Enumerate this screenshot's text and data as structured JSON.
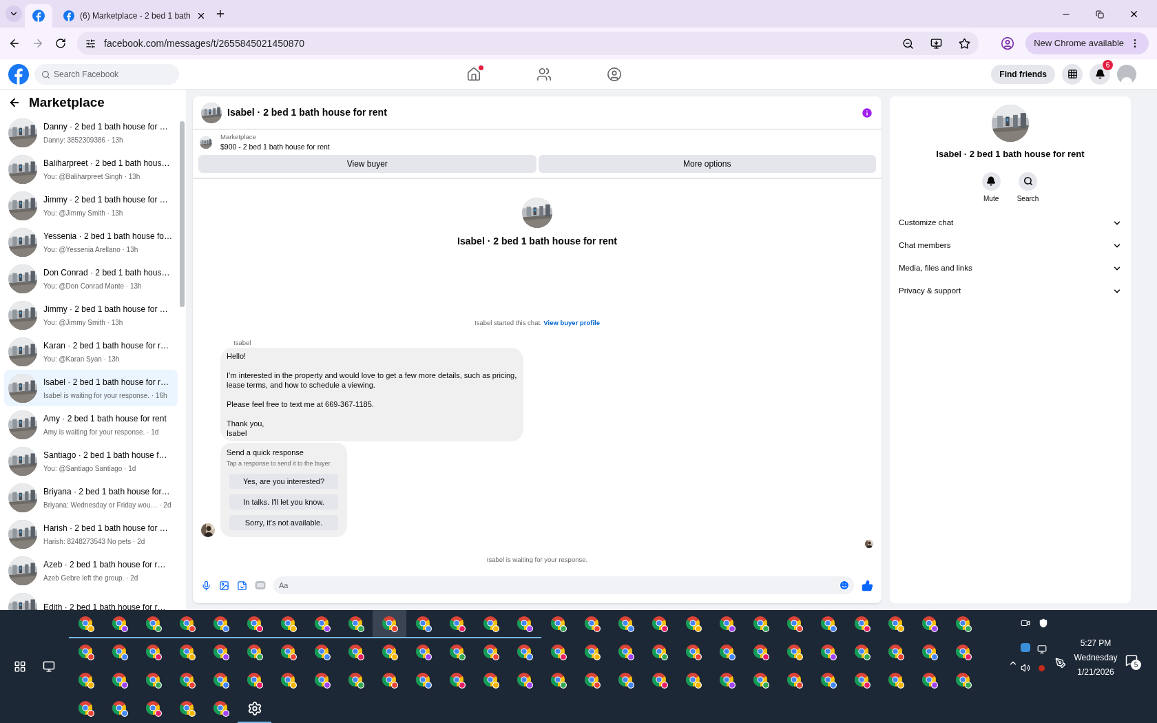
{
  "browser": {
    "tabs": [
      {
        "kind": "icon",
        "selected": true
      },
      {
        "kind": "page",
        "title": "(6) Marketplace - 2 bed 1 bath",
        "selected": false
      }
    ],
    "url": "facebook.com/messages/t/2655845021450870",
    "update_label": "New Chrome available"
  },
  "facebook": {
    "search_placeholder": "Search Facebook",
    "nav": [
      {
        "kind": "home",
        "dot": true
      },
      {
        "kind": "friends",
        "dot": false
      },
      {
        "kind": "groups",
        "dot": false
      }
    ],
    "find_friends": "Find friends",
    "notifications_badge": "6"
  },
  "sidebar": {
    "title": "Marketplace",
    "conversations": [
      {
        "title": "Danny · 2 bed 1 bath house for …",
        "subtitle": "Danny: 3852309386 · 13h",
        "selected": false
      },
      {
        "title": "Baliharpreet · 2 bed 1 bath hous…",
        "subtitle": "You: @Baliharpreet Singh · 13h",
        "selected": false
      },
      {
        "title": "Jimmy · 2 bed 1 bath house for …",
        "subtitle": "You: @Jimmy Smith · 13h",
        "selected": false
      },
      {
        "title": "Yessenia · 2 bed 1 bath house fo…",
        "subtitle": "You: @Yessenia Arellano · 13h",
        "selected": false
      },
      {
        "title": "Don Conrad · 2 bed 1 bath hous…",
        "subtitle": "You: @Don Conrad Mante · 13h",
        "selected": false
      },
      {
        "title": "Jimmy · 2 bed 1 bath house for …",
        "subtitle": "You: @Jimmy Smith · 13h",
        "selected": false
      },
      {
        "title": "Karan · 2 bed 1 bath house for r…",
        "subtitle": "You: @Karan Syan · 13h",
        "selected": false
      },
      {
        "title": "Isabel · 2 bed 1 bath house for r…",
        "subtitle": "Isabel is waiting for your response. · 16h",
        "selected": true
      },
      {
        "title": "Amy · 2 bed 1 bath house for rent",
        "subtitle": "Amy is waiting for your response. · 1d",
        "selected": false
      },
      {
        "title": "Santiago · 2 bed 1 bath house f…",
        "subtitle": "You: @Santiago Santiago · 1d",
        "selected": false
      },
      {
        "title": "Briyana · 2 bed 1 bath house for…",
        "subtitle": "Briyana: Wednesday or Friday wou… · 2d",
        "selected": false
      },
      {
        "title": "Harish · 2 bed 1 bath house for …",
        "subtitle": "Harish: 8248273543 No pets · 2d",
        "selected": false
      },
      {
        "title": "Azeb · 2 bed 1 bath house for r…",
        "subtitle": "Azeb Gebre left the group. · 2d",
        "selected": false
      },
      {
        "title": "Edith · 2 bed 1 bath house for r…",
        "selected": false
      }
    ]
  },
  "chat": {
    "title": "Isabel · 2 bed 1 bath house for rent",
    "listing": {
      "label": "Marketplace",
      "name": "$900 - 2 bed 1 bath house for rent",
      "buttons": [
        "View buyer",
        "More options"
      ]
    },
    "intro_title": "Isabel · 2 bed 1 bath house for rent",
    "started_text": "Isabel started this chat.",
    "started_link": "View buyer profile",
    "sender": "Isabel",
    "message": [
      "Hello!",
      "I’m interested in the property and would love to get a few more details, such as pricing, lease terms, and how to schedule a viewing.",
      "Please feel free to text me at 669-367-1185.",
      "Thank you,\nIsabel"
    ],
    "quick_response": {
      "title": "Send a quick response",
      "hint": "Tap a response to send it to the buyer.",
      "options": [
        "Yes, are you interested?",
        "In talks. I'll let you know.",
        "Sorry, it's not available."
      ]
    },
    "waiting_text": "Isabel is waiting for your response.",
    "composer_placeholder": "Aa"
  },
  "details": {
    "title": "Isabel · 2 bed 1 bath house for rent",
    "actions": [
      {
        "kind": "mute",
        "label": "Mute"
      },
      {
        "kind": "search",
        "label": "Search"
      }
    ],
    "sections": [
      {
        "label": "Customize chat",
        "expanded": false
      },
      {
        "label": "Chat members",
        "expanded": false
      },
      {
        "label": "Media, files and links",
        "expanded": false
      },
      {
        "label": "Privacy & support",
        "expanded": false
      }
    ]
  },
  "taskbar": {
    "apps": [
      {
        "kind": "chrome",
        "running": true,
        "active": false
      },
      {
        "kind": "chrome",
        "running": true,
        "active": false
      },
      {
        "kind": "chrome",
        "running": true,
        "active": false
      },
      {
        "kind": "chrome",
        "running": true,
        "active": false
      },
      {
        "kind": "chrome",
        "running": true,
        "active": false
      },
      {
        "kind": "chrome",
        "running": true,
        "active": false
      },
      {
        "kind": "chrome",
        "running": true,
        "active": false
      },
      {
        "kind": "chrome",
        "running": true,
        "active": false
      },
      {
        "kind": "chrome",
        "running": true,
        "active": false
      },
      {
        "kind": "chrome",
        "running": true,
        "active": true
      },
      {
        "kind": "chrome",
        "running": true,
        "active": false
      },
      {
        "kind": "chrome",
        "running": true,
        "active": false
      },
      {
        "kind": "chrome",
        "running": true,
        "active": false
      },
      {
        "kind": "chrome",
        "running": true,
        "active": false
      },
      {
        "kind": "chrome",
        "running": false,
        "active": false
      },
      {
        "kind": "chrome",
        "running": false,
        "active": false
      },
      {
        "kind": "chrome",
        "running": false,
        "active": false
      },
      {
        "kind": "chrome",
        "running": false,
        "active": false
      },
      {
        "kind": "chrome",
        "running": false,
        "active": false
      },
      {
        "kind": "chrome",
        "running": false,
        "active": false
      },
      {
        "kind": "chrome",
        "running": false,
        "active": false
      },
      {
        "kind": "chrome",
        "running": false,
        "active": false
      },
      {
        "kind": "chrome",
        "running": false,
        "active": false
      },
      {
        "kind": "chrome",
        "running": false,
        "active": false
      },
      {
        "kind": "chrome",
        "running": false,
        "active": false
      },
      {
        "kind": "chrome",
        "running": false,
        "active": false
      },
      {
        "kind": "chrome",
        "running": false,
        "active": false
      },
      {
        "kind": "chrome",
        "running": false,
        "active": false
      },
      {
        "kind": "chrome",
        "running": false,
        "active": false
      },
      {
        "kind": "chrome",
        "running": false,
        "active": false
      },
      {
        "kind": "chrome",
        "running": false,
        "active": false
      },
      {
        "kind": "chrome",
        "running": false,
        "active": false
      },
      {
        "kind": "chrome",
        "running": false,
        "active": false
      },
      {
        "kind": "chrome",
        "running": false,
        "active": false
      },
      {
        "kind": "chrome",
        "running": false,
        "active": false
      },
      {
        "kind": "chrome",
        "running": false,
        "active": false
      },
      {
        "kind": "chrome",
        "running": false,
        "active": false
      },
      {
        "kind": "chrome",
        "running": false,
        "active": false
      },
      {
        "kind": "chrome",
        "running": false,
        "active": false
      },
      {
        "kind": "chrome",
        "running": false,
        "active": false
      },
      {
        "kind": "chrome",
        "running": false,
        "active": false
      },
      {
        "kind": "chrome",
        "running": false,
        "active": false
      },
      {
        "kind": "chrome",
        "running": false,
        "active": false
      },
      {
        "kind": "chrome",
        "running": false,
        "active": false
      },
      {
        "kind": "chrome",
        "running": false,
        "active": false
      },
      {
        "kind": "chrome",
        "running": false,
        "active": false
      },
      {
        "kind": "chrome",
        "running": false,
        "active": false
      },
      {
        "kind": "chrome",
        "running": false,
        "active": false
      },
      {
        "kind": "chrome",
        "running": false,
        "active": false
      },
      {
        "kind": "chrome",
        "running": false,
        "active": false
      },
      {
        "kind": "chrome",
        "running": false,
        "active": false
      },
      {
        "kind": "chrome",
        "running": false,
        "active": false
      },
      {
        "kind": "chrome",
        "running": false,
        "active": false
      },
      {
        "kind": "chrome",
        "running": false,
        "active": false
      },
      {
        "kind": "chrome",
        "running": false,
        "active": false
      },
      {
        "kind": "chrome",
        "running": false,
        "active": false
      },
      {
        "kind": "chrome",
        "running": false,
        "active": false
      },
      {
        "kind": "chrome",
        "running": false,
        "active": false
      },
      {
        "kind": "chrome",
        "running": false,
        "active": false
      },
      {
        "kind": "chrome",
        "running": false,
        "active": false
      },
      {
        "kind": "chrome",
        "running": false,
        "active": false
      },
      {
        "kind": "chrome",
        "running": false,
        "active": false
      },
      {
        "kind": "chrome",
        "running": false,
        "active": false
      },
      {
        "kind": "chrome",
        "running": false,
        "active": false
      },
      {
        "kind": "chrome",
        "running": false,
        "active": false
      },
      {
        "kind": "chrome",
        "running": false,
        "active": false
      },
      {
        "kind": "chrome",
        "running": false,
        "active": false
      },
      {
        "kind": "chrome",
        "running": false,
        "active": false
      },
      {
        "kind": "chrome",
        "running": false,
        "active": false
      },
      {
        "kind": "chrome",
        "running": false,
        "active": false
      },
      {
        "kind": "chrome",
        "running": false,
        "active": false
      },
      {
        "kind": "chrome",
        "running": false,
        "active": false
      },
      {
        "kind": "chrome",
        "running": false,
        "active": false
      },
      {
        "kind": "chrome",
        "running": false,
        "active": false
      },
      {
        "kind": "chrome",
        "running": false,
        "active": false
      },
      {
        "kind": "chrome",
        "running": false,
        "active": false
      },
      {
        "kind": "chrome",
        "running": false,
        "active": false
      },
      {
        "kind": "chrome",
        "running": false,
        "active": false
      },
      {
        "kind": "chrome",
        "running": false,
        "active": false
      },
      {
        "kind": "chrome",
        "running": false,
        "active": false
      },
      {
        "kind": "chrome",
        "running": false,
        "active": false
      },
      {
        "kind": "chrome",
        "running": false,
        "active": false
      },
      {
        "kind": "chrome",
        "running": false,
        "active": false
      },
      {
        "kind": "chrome",
        "running": false,
        "active": false
      },
      {
        "kind": "chrome",
        "running": false,
        "active": false
      },
      {
        "kind": "chrome",
        "running": false,
        "active": false
      },
      {
        "kind": "settings",
        "running": true,
        "active": false
      }
    ],
    "clock": {
      "time": "5:27 PM",
      "day": "Wednesday",
      "date": "1/21/2026"
    },
    "notification_count": "5"
  }
}
